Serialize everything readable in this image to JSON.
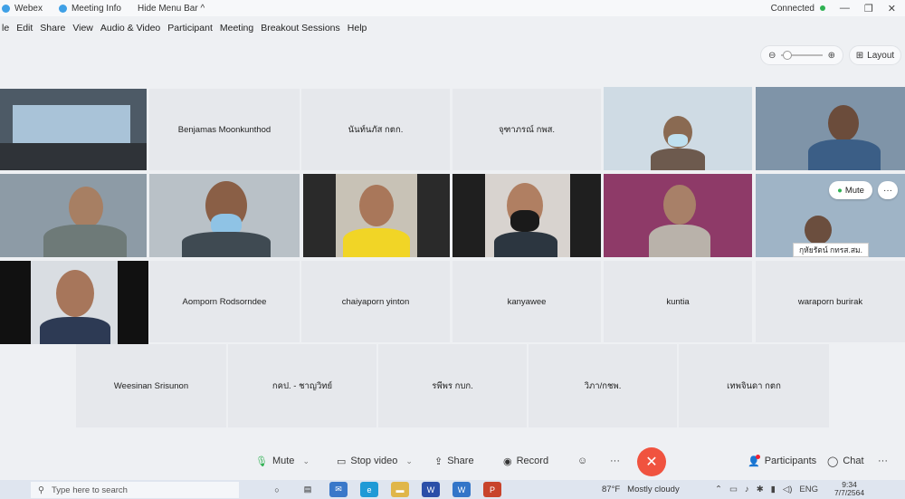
{
  "titlebar": {
    "app": "Webex",
    "meeting_info": "Meeting Info",
    "hide_menu": "Hide Menu Bar ^",
    "status": "Connected",
    "win_min": "—",
    "win_max": "❐",
    "win_close": "✕"
  },
  "menu": [
    "le",
    "Edit",
    "Share",
    "View",
    "Audio & Video",
    "Participant",
    "Meeting",
    "Breakout Sessions",
    "Help"
  ],
  "toolbar": {
    "layout_label": "Layout",
    "zoom_out": "⊖",
    "zoom_in": "⊕"
  },
  "tiles": {
    "row1": [
      "Benjamas Moonkunthod",
      "นันท์นภัส กตก.",
      "จุฑาภรณ์ กพส."
    ],
    "row3": [
      "Aomporn Rodsorndee",
      "chaiyaporn yinton",
      "kanyawee",
      "kuntia",
      "waraporn burirak"
    ],
    "row4": [
      "Weesinan Srisunon",
      "กคป. - ชาญวิทย์",
      "รพีพร กบก.",
      "วิภา/กชพ.",
      "เทพจินดา กตก"
    ]
  },
  "hover": {
    "mute_label": "Mute",
    "more_label": "···",
    "tooltip": "กุหัยรัตน์ กทรส.สม."
  },
  "controls": {
    "mute": "Mute",
    "stop_video": "Stop video",
    "share": "Share",
    "record": "Record",
    "more": "···",
    "end": "✕",
    "participants": "Participants",
    "chat": "Chat",
    "overflow": "···"
  },
  "taskbar": {
    "search_placeholder": "Type here to search",
    "weather": "87°F",
    "weather_desc": "Mostly cloudy",
    "lang": "ENG",
    "time": "9:34",
    "date": "7/7/2564"
  },
  "colors": {
    "accent": "#2fb152",
    "end_call": "#f0533f",
    "background": "#eef0f3"
  }
}
